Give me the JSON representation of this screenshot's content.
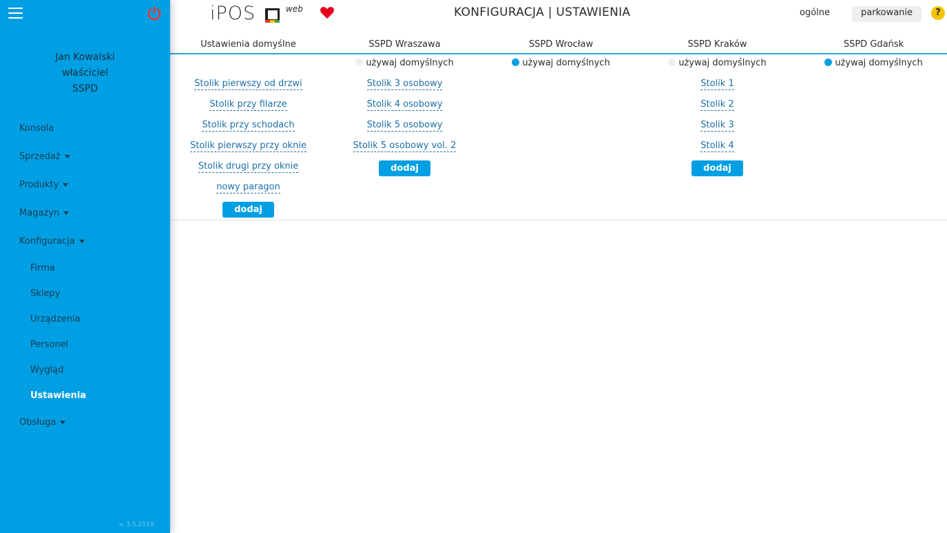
{
  "user": {
    "name": "Jan Kowalski",
    "role": "właściciel",
    "company": "SSPD"
  },
  "nav": {
    "items": [
      {
        "label": "Konsola"
      },
      {
        "label": "Sprzedaż"
      },
      {
        "label": "Produkty"
      },
      {
        "label": "Magazyn"
      },
      {
        "label": "Konfiguracja"
      },
      {
        "label": "Obsługa"
      }
    ],
    "sub_items": [
      {
        "label": "Firma"
      },
      {
        "label": "Sklepy"
      },
      {
        "label": "Urządzenia"
      },
      {
        "label": "Personel"
      },
      {
        "label": "Wygląd"
      },
      {
        "label": "Ustawienia",
        "active": true
      }
    ]
  },
  "version": "v. 3.5.2119",
  "header": {
    "logo_text": "iPOS",
    "logo_suffix": "web",
    "title": "KONFIGURACJA | USTAWIENIA",
    "general_label": "ogólne",
    "parking_label": "parkowanie",
    "help_label": "?"
  },
  "columns": [
    {
      "title": "Ustawienia domyślne",
      "links": [
        "Stolik pierwszy od drzwi",
        "Stolik przy filarze",
        "Stolik przy schodach",
        "Stolik pierwszy przy oknie",
        "Stolik drugi przy oknie",
        "nowy paragon"
      ],
      "add_label": "dodaj"
    },
    {
      "title": "SSPD Wraszawa",
      "use_defaults_label": "używaj domyślnych",
      "use_defaults": false,
      "links": [
        "Stolik 3 osobowy",
        "Stolik 4 osobowy",
        "Stolik 5 osobowy",
        "Stolik 5 osobowy vol. 2"
      ],
      "add_label": "dodaj"
    },
    {
      "title": "SSPD Wrocław",
      "use_defaults_label": "używaj domyślnych",
      "use_defaults": true,
      "links": []
    },
    {
      "title": "SSPD Kraków",
      "use_defaults_label": "używaj domyślnych",
      "use_defaults": false,
      "links": [
        "Stolik 1",
        "Stolik 2",
        "Stolik 3",
        "Stolik 4"
      ],
      "add_label": "dodaj"
    },
    {
      "title": "SSPD Gdańsk",
      "use_defaults_label": "używaj domyślnych",
      "use_defaults": true,
      "links": []
    }
  ],
  "colors": {
    "sidebar": "#009fe3",
    "accent": "#009fe3",
    "logout": "#e53935",
    "heart": "#e8001c",
    "help": "#f5c400"
  }
}
